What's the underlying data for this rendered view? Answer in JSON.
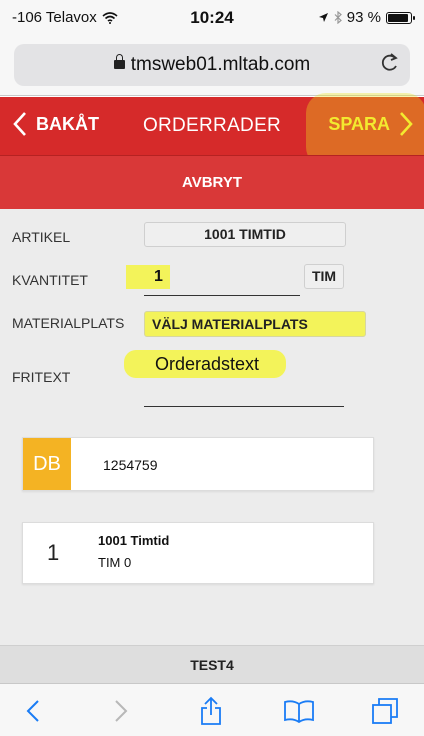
{
  "status_bar": {
    "carrier": "-106 Telavox",
    "time": "10:24",
    "battery": "93 %",
    "battery_level": 0.93
  },
  "browser": {
    "url": "tmsweb01.mltab.com",
    "reload_symbol": "C"
  },
  "header": {
    "back_label": "BAKÅT",
    "title": "ORDERRADER",
    "save_label": "SPARA"
  },
  "cancel_label": "AVBRYT",
  "form": {
    "artikel": {
      "label": "ARTIKEL",
      "value": "1001 TIMTID"
    },
    "kvantitet": {
      "label": "KVANTITET",
      "value": "1",
      "unit": "TIM"
    },
    "materialplats": {
      "label": "MATERIALPLATS",
      "value": "VÄLJ MATERIALPLATS"
    },
    "fritext": {
      "label": "FRITEXT",
      "value": "Orderadstext"
    }
  },
  "cards": [
    {
      "badge": "DB",
      "text": "1254759"
    },
    {
      "number": "1",
      "title": "1001 Timtid",
      "subtitle": "TIM 0"
    }
  ],
  "footer": {
    "label": "TEST4"
  },
  "colors": {
    "header_red": "#d62a2a",
    "save_yellow": "#f7ef3a",
    "highlight": "#f3f35a",
    "badge_orange": "#f4b323",
    "ios_blue": "#1a7cf5"
  },
  "icons": [
    "wifi-icon",
    "location-arrow-icon",
    "bluetooth-icon",
    "battery-icon",
    "lock-icon",
    "reload-icon",
    "chevron-left-icon",
    "chevron-right-icon",
    "share-icon",
    "bookmarks-icon",
    "tabs-icon"
  ]
}
